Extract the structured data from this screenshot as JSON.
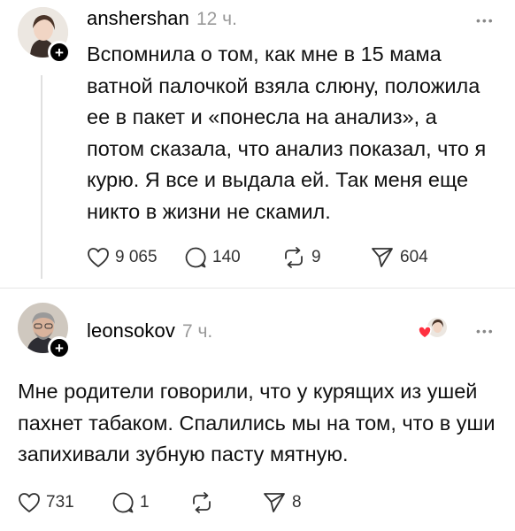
{
  "post1": {
    "username": "anshershan",
    "time": "12 ч.",
    "more": "•••",
    "text": "Вспомнила о том, как мне в 15 мама ватной палочкой взяла слюну, положила ее в пакет и «понесла на анализ», а потом сказала, что анализ показал, что я курю. Я все и выдала ей. Так меня еще никто в жизни не скамил.",
    "likes": "9 065",
    "replies": "140",
    "reposts": "9",
    "shares": "604"
  },
  "post2": {
    "username": "leonsokov",
    "time": "7 ч.",
    "more": "•••",
    "text": "Мне родители говорили, что у курящих из ушей пахнет табаком. Спалились мы на том, что в уши запихивали зубную пасту мятную.",
    "likes": "731",
    "replies": "1",
    "reposts": "",
    "shares": "8"
  },
  "icons": {
    "plus": "+",
    "like": "heart-icon",
    "reply": "comment-icon",
    "repost": "repost-icon",
    "share": "send-icon"
  }
}
